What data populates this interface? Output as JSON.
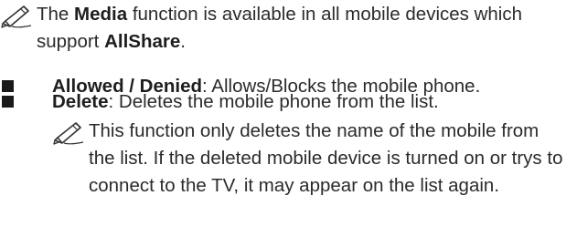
{
  "note_top": {
    "icon": "pencil-note-icon",
    "prefix": "The ",
    "bold1": "Media",
    "middle": " function is available in all mobile devices which support ",
    "bold2": "AllShare",
    "suffix": "."
  },
  "bullets": [
    {
      "icon": "square-bullet-icon",
      "term": "Allowed / Denied",
      "desc": ": Allows/Blocks the mobile phone."
    },
    {
      "icon": "square-bullet-icon",
      "term": "Delete",
      "desc": ": Deletes the mobile phone from the list."
    }
  ],
  "note_sub": {
    "icon": "pencil-note-icon",
    "text": "This function only deletes the name of the mobile from the list. If the deleted mobile device is turned on or trys to connect to the TV, it may appear on the list again."
  }
}
